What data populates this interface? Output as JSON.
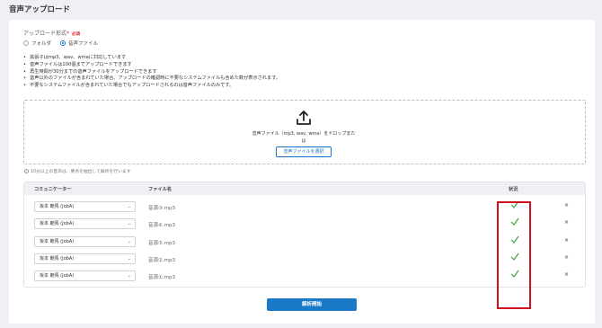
{
  "page": {
    "title": "音声アップロード"
  },
  "upload_format": {
    "label": "アップロード形式",
    "required_mark": "*",
    "required_badge": "必須",
    "options": [
      {
        "label": "フォルダ",
        "selected": false
      },
      {
        "label": "音声ファイル",
        "selected": true
      }
    ]
  },
  "notes": [
    "拡張子はmp3、wav、wmaに対応しています",
    "音声ファイルは100個までアップロードできます",
    "再生時間が30分までの音声ファイルをアップロードできます",
    "音声以外のファイルが含まれていた場合、アップロードの確認時に不要なシステムファイルも含めた数が表示されます。",
    "不要なシステムファイルが含まれていた場合でもアップロードされるのは音声ファイルのみです。"
  ],
  "dropzone": {
    "icon": "upload-icon",
    "text": "音声ファイル（mp3, wav, wma）をドロップまたは",
    "button_label": "音声ファイルを選択"
  },
  "info_note": "10分以上の音声は、要点を抽出して解析を行います",
  "table": {
    "headers": {
      "communicator": "コミュニケーター",
      "filename": "ファイル名",
      "status": "状況"
    },
    "rows": [
      {
        "communicator": "坂本 範馬 (JobA)",
        "filename": "音源③.mp3",
        "status": "check-icon",
        "remove": "×"
      },
      {
        "communicator": "坂本 範馬 (JobA)",
        "filename": "音源④.mp3",
        "status": "check-icon",
        "remove": "×"
      },
      {
        "communicator": "坂本 範馬 (JobA)",
        "filename": "音源⑤.mp3",
        "status": "check-icon",
        "remove": "×"
      },
      {
        "communicator": "坂本 範馬 (JobA)",
        "filename": "音源②.mp3",
        "status": "check-icon",
        "remove": "×"
      },
      {
        "communicator": "坂本 範馬 (JobA)",
        "filename": "音源①.mp3",
        "status": "check-icon",
        "remove": "×"
      }
    ]
  },
  "submit": {
    "label": "解析開始"
  },
  "colors": {
    "accent": "#1a7ac8",
    "check": "#3aa53a",
    "highlight": "#d0101e",
    "required": "#dd2233"
  }
}
